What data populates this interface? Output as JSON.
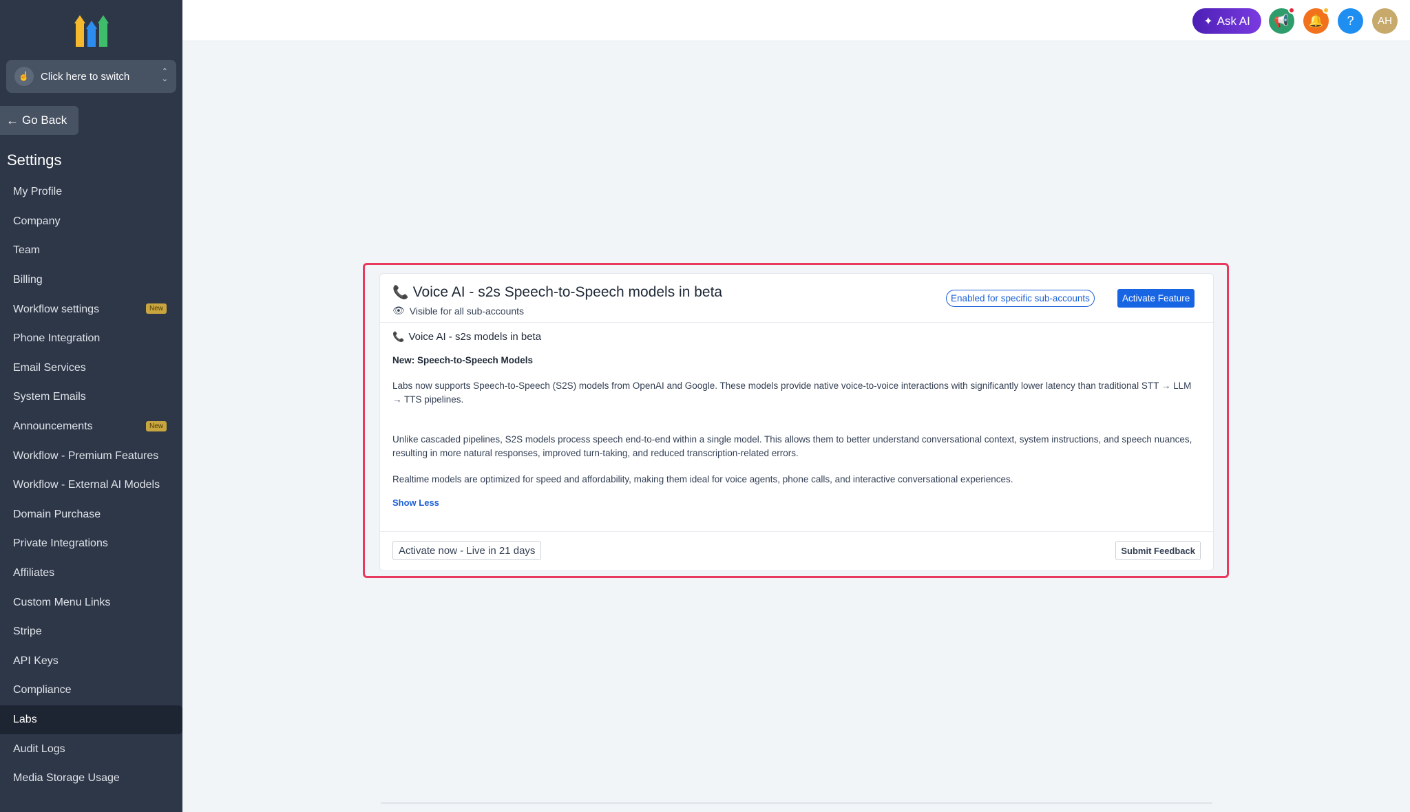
{
  "sidebar": {
    "switcher_label": "Click here to switch",
    "go_back": "Go Back",
    "settings_title": "Settings",
    "new_badge": "New",
    "items": [
      {
        "label": "My Profile"
      },
      {
        "label": "Company"
      },
      {
        "label": "Team"
      },
      {
        "label": "Billing"
      },
      {
        "label": "Workflow settings",
        "badge": "New"
      },
      {
        "label": "Phone Integration"
      },
      {
        "label": "Email Services"
      },
      {
        "label": "System Emails"
      },
      {
        "label": "Announcements",
        "badge": "New"
      },
      {
        "label": "Workflow - Premium Features"
      },
      {
        "label": "Workflow - External AI Models"
      },
      {
        "label": "Domain Purchase"
      },
      {
        "label": "Private Integrations"
      },
      {
        "label": "Affiliates"
      },
      {
        "label": "Custom Menu Links"
      },
      {
        "label": "Stripe"
      },
      {
        "label": "API Keys"
      },
      {
        "label": "Compliance"
      },
      {
        "label": "Labs",
        "active": true
      },
      {
        "label": "Audit Logs"
      },
      {
        "label": "Media Storage Usage"
      }
    ]
  },
  "topbar": {
    "ask_ai": "Ask AI",
    "help": "?",
    "avatar_initials": "AH",
    "colors": {
      "announce": "#2e9d6b",
      "bell": "#f2711c",
      "help": "#1f8ef1",
      "avatar": "#c6a96b"
    }
  },
  "card": {
    "title": "Voice AI - s2s Speech-to-Speech models in beta",
    "visibility": "Visible for all sub-accounts",
    "enabled_pill": "Enabled for specific sub-accounts",
    "activate_button": "Activate Feature",
    "subtitle": "Voice AI - s2s models in beta",
    "heading": "New: Speech-to-Speech Models",
    "paragraph1": "Labs now supports Speech-to-Speech (S2S) models from OpenAI and Google. These models provide native voice-to-voice interactions with significantly lower latency than traditional STT → LLM → TTS pipelines.",
    "paragraph2": "Unlike cascaded pipelines, S2S models process speech end-to-end within a single model. This allows them to better understand conversational context, system instructions, and speech nuances, resulting in more natural responses, improved turn-taking, and reduced transcription-related errors.",
    "paragraph3": "Realtime models are optimized for speed and affordability, making them ideal for voice agents, phone calls, and interactive conversational experiences.",
    "show_less": "Show Less",
    "live_button": "Activate now - Live in 21 days",
    "feedback_button": "Submit Feedback"
  },
  "accent_colors": {
    "highlight_border": "#e8395f",
    "primary_blue": "#1765e3"
  }
}
